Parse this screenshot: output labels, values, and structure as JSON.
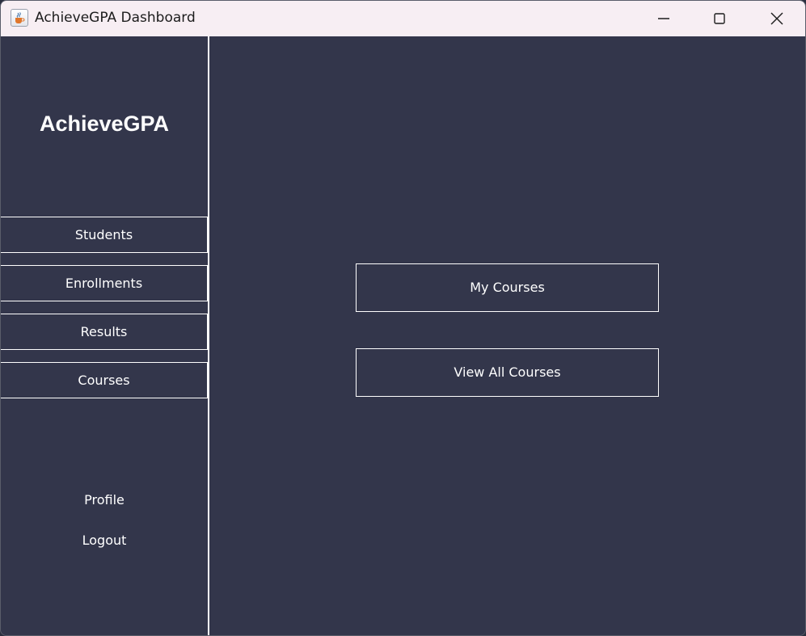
{
  "window": {
    "title": "AchieveGPA Dashboard",
    "icon": "java-cup-icon"
  },
  "sidebar": {
    "brand": "AchieveGPA",
    "nav": [
      {
        "label": "Students"
      },
      {
        "label": "Enrollments"
      },
      {
        "label": "Results"
      },
      {
        "label": "Courses"
      }
    ],
    "links": [
      {
        "label": "Profile"
      },
      {
        "label": "Logout"
      }
    ]
  },
  "main": {
    "buttons": [
      {
        "label": "My Courses"
      },
      {
        "label": "View All Courses"
      }
    ]
  },
  "colors": {
    "background": "#33364b",
    "titlebar": "#f7eef3",
    "text": "#ffffff",
    "border": "#ffffff"
  }
}
